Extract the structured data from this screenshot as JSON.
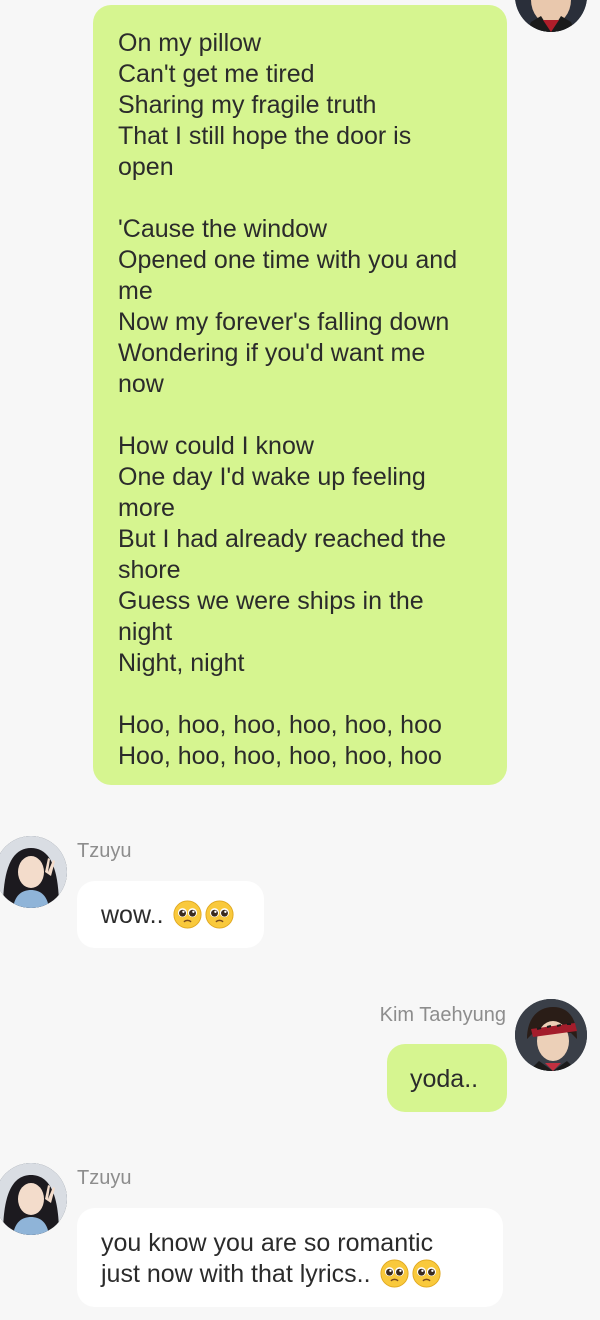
{
  "messages": {
    "lyrics": {
      "lines": [
        "On my pillow",
        "Can't get me tired",
        "Sharing my fragile truth",
        "That I still hope the door is",
        "open",
        "",
        "'Cause the window",
        "Opened one time with you and",
        "me",
        "Now my forever's falling down",
        "Wondering if you'd want me",
        "now",
        "",
        "How could I know",
        "One day I'd wake up feeling",
        "more",
        "But I had already reached the",
        "shore",
        "Guess we were ships in the",
        "night",
        "Night, night",
        "",
        "Hoo, hoo, hoo, hoo, hoo, hoo",
        "Hoo, hoo, hoo, hoo, hoo, hoo"
      ]
    },
    "tzuyu_1": {
      "sender": "Tzuyu",
      "text": "wow.. ",
      "emoji": "pleading-face-emoji"
    },
    "taehyung_1": {
      "sender": "Kim Taehyung",
      "text": "yoda.."
    },
    "tzuyu_2": {
      "sender": "Tzuyu",
      "line1": "you know you are so romantic",
      "line2": "just now with that lyrics.. ",
      "emoji": "pleading-face-emoji"
    }
  },
  "colors": {
    "my_bubble": "#d6f590",
    "their_bubble": "#ffffff",
    "background": "#f7f7f7",
    "sender_name": "#8d8d8d"
  },
  "icons": {
    "avatar_tzuyu": "avatar-tzuyu",
    "avatar_taehyung": "avatar-kim-taehyung"
  }
}
